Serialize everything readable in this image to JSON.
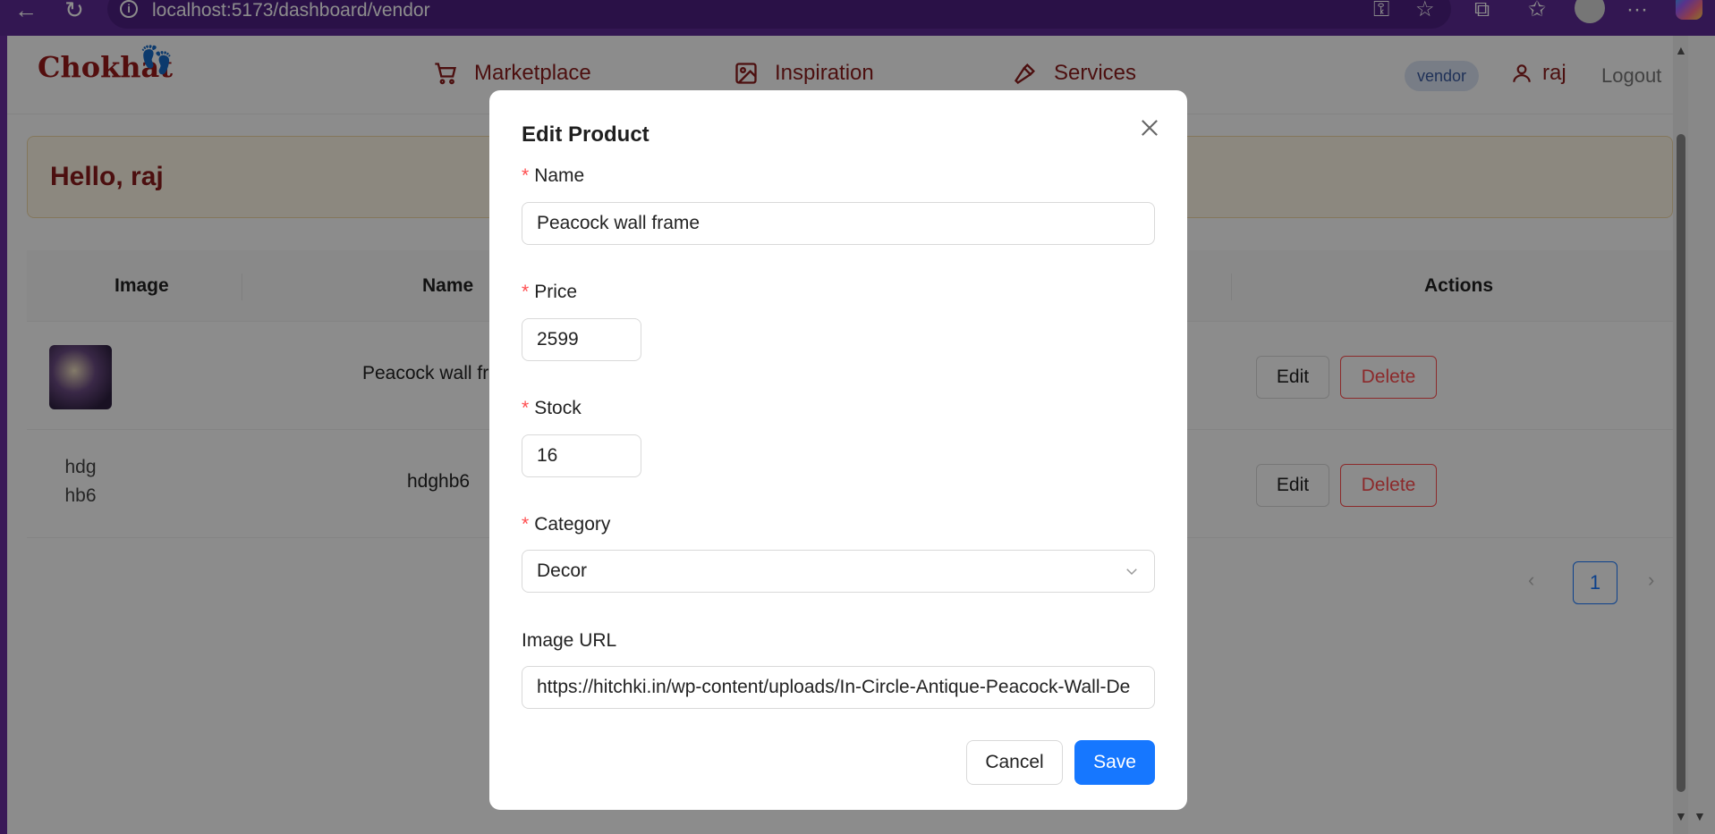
{
  "browser": {
    "url": "localhost:5173/dashboard/vendor",
    "icons": [
      "back-icon",
      "reload-icon",
      "info-icon",
      "key-icon",
      "star-icon",
      "extensions-icon",
      "favorites-icon",
      "profile-icon",
      "more-icon",
      "copilot-icon"
    ]
  },
  "header": {
    "logo": "Chokhat",
    "nav": [
      {
        "label": "Marketplace",
        "icon": "cart-icon"
      },
      {
        "label": "Inspiration",
        "icon": "image-icon"
      },
      {
        "label": "Services",
        "icon": "hammer-icon"
      }
    ],
    "role_badge": "vendor",
    "username": "raj",
    "logout": "Logout"
  },
  "greeting": "Hello, raj",
  "table": {
    "columns": [
      "Image",
      "Name",
      "Actions"
    ],
    "rows": [
      {
        "image_alt": "",
        "name": "Peacock wall fra",
        "edit": "Edit",
        "delete": "Delete"
      },
      {
        "image_alt": "hdg hb6",
        "name": "hdghb6",
        "edit": "Edit",
        "delete": "Delete"
      }
    ]
  },
  "pagination": {
    "current": "1",
    "prev": "‹",
    "next": "›"
  },
  "modal": {
    "title": "Edit Product",
    "fields": {
      "name": {
        "label": "Name",
        "value": "Peacock wall frame",
        "required": true
      },
      "price": {
        "label": "Price",
        "value": "2599",
        "required": true
      },
      "stock": {
        "label": "Stock",
        "value": "16",
        "required": true
      },
      "category": {
        "label": "Category",
        "value": "Decor",
        "required": true
      },
      "image_url": {
        "label": "Image URL",
        "value": "https://hitchki.in/wp-content/uploads/In-Circle-Antique-Peacock-Wall-De",
        "required": false
      }
    },
    "cancel": "Cancel",
    "save": "Save"
  },
  "colors": {
    "brand": "#8b1c1c",
    "primary": "#1677ff",
    "danger": "#ff4d4f",
    "chrome": "#5e2b95"
  }
}
